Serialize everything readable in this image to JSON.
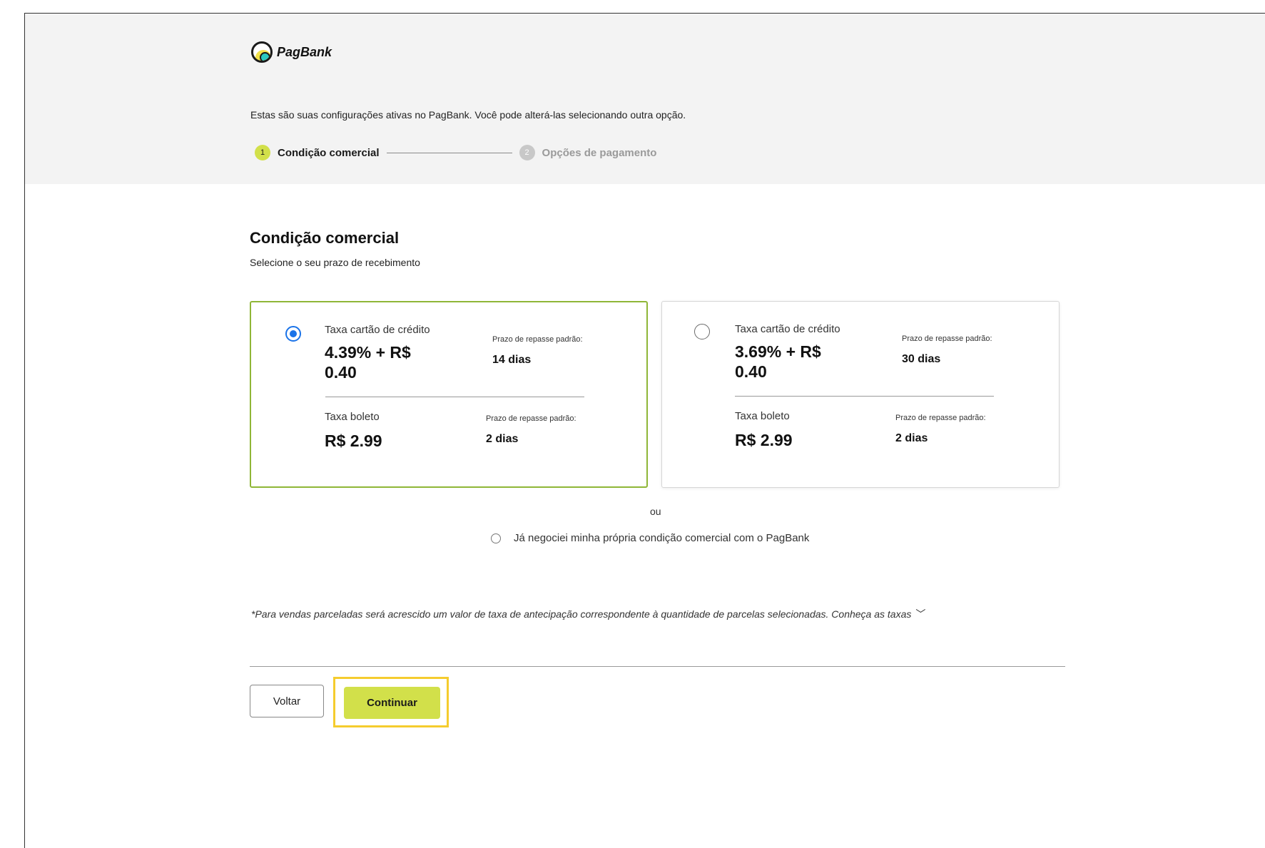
{
  "brand": {
    "name": "PagBank"
  },
  "intro": "Estas são suas configurações ativas no PagBank. Você pode alterá-las selecionando outra opção.",
  "stepper": {
    "steps": [
      {
        "number": "1",
        "label": "Condição comercial",
        "active": true
      },
      {
        "number": "2",
        "label": "Opções de pagamento",
        "active": false
      }
    ]
  },
  "section": {
    "title": "Condição comercial",
    "subtitle": "Selecione o seu prazo de recebimento"
  },
  "plans": [
    {
      "selected": true,
      "credit_label": "Taxa cartão de crédito",
      "credit_rate_line1": "4.39% + R$",
      "credit_rate_line2": "0.40",
      "credit_term_label": "Prazo de repasse padrão:",
      "credit_term_value": "14 dias",
      "boleto_label": "Taxa boleto",
      "boleto_rate": "R$ 2.99",
      "boleto_term_label": "Prazo de repasse padrão:",
      "boleto_term_value": "2 dias"
    },
    {
      "selected": false,
      "credit_label": "Taxa cartão de crédito",
      "credit_rate_line1": "3.69% + R$",
      "credit_rate_line2": "0.40",
      "credit_term_label": "Prazo de repasse padrão:",
      "credit_term_value": "30 dias",
      "boleto_label": "Taxa boleto",
      "boleto_rate": "R$ 2.99",
      "boleto_term_label": "Prazo de repasse padrão:",
      "boleto_term_value": "2 dias"
    }
  ],
  "or_text": "ou",
  "own_condition_label": "Já negociei minha própria condição comercial com o PagBank",
  "note": "*Para vendas parceladas será acrescido um valor de taxa de antecipação correspondente à quantidade de parcelas selecionadas. Conheça as taxas",
  "buttons": {
    "back": "Voltar",
    "continue": "Continuar"
  },
  "colors": {
    "accent": "#d2e04a",
    "selected_border": "#8fb637",
    "radio": "#1a73e8",
    "highlight": "#f5cc2e"
  }
}
